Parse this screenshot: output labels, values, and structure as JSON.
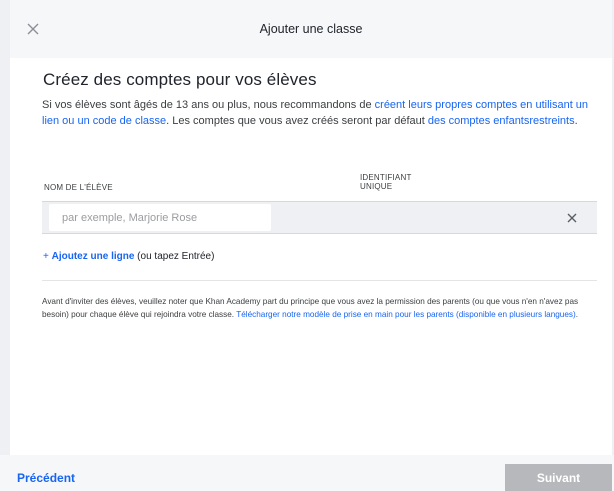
{
  "header": {
    "title": "Ajouter une classe",
    "close_icon": "close-icon"
  },
  "main": {
    "heading": "Créez des comptes pour vos élèves",
    "intro": {
      "text_1": "Si vos élèves sont âgés de 13 ans ou plus, nous recommandons de ",
      "link_1": "créent leurs propres comptes en utilisant un lien ou un code de classe",
      "text_2": ". Les comptes que vous avez créés seront par défaut ",
      "link_2": "des comptes enfantsrestreints",
      "text_3": "."
    },
    "columns": {
      "name": "NOM DE L'ÉLÈVE",
      "identifier": "IDENTIFIANT UNIQUE"
    },
    "row": {
      "name_value": "",
      "name_placeholder": "par exemple, Marjorie Rose",
      "remove_icon": "close-icon"
    },
    "add_line": {
      "plus": "+",
      "link": "Ajoutez une ligne",
      "hint": " (ou tapez Entrée)"
    },
    "note": {
      "text": "Avant d'inviter des élèves, veuillez noter que Khan Academy part du principe que vous avez la permission des parents (ou que vous n'en n'avez pas besoin) pour chaque élève qui rejoindra votre classe. ",
      "link": "Télécharger notre modèle de prise en main pour les parents (disponible en plusieurs langues)",
      "end": "."
    }
  },
  "footer": {
    "prev_label": "Précédent",
    "next_label": "Suivant"
  },
  "colors": {
    "link": "#1865f2",
    "disabled_button": "#b6b8bc",
    "background": "#eef0f3"
  }
}
